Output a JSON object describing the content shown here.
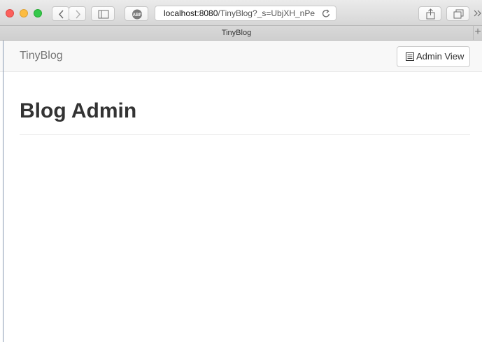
{
  "browser": {
    "url_host": "localhost:8080",
    "url_path": "/TinyBlog?_s=UbjXH_nPe",
    "tab_title": "TinyBlog",
    "new_tab_glyph": "+"
  },
  "navbar": {
    "brand": "TinyBlog",
    "admin_button_label": "Admin View",
    "admin_button_icon": "list-alt-icon"
  },
  "main": {
    "title": "Blog Admin"
  }
}
